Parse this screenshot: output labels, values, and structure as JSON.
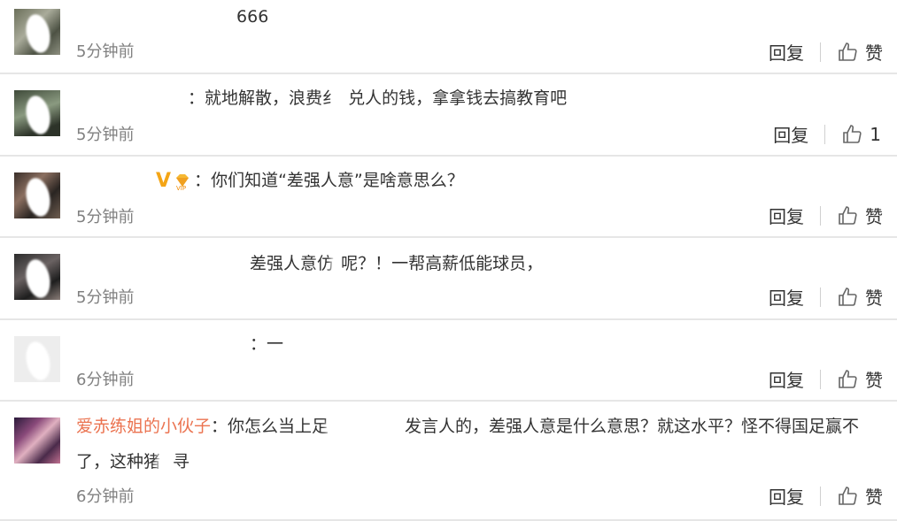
{
  "comments": [
    {
      "username": "",
      "text": "666",
      "time": "5分钟前",
      "reply_label": "回复",
      "like_label": "赞"
    },
    {
      "username": "",
      "text_a": "：就地解散，浪费纟",
      "text_b": "兑人的钱，拿拿钱去搞教育吧",
      "time": "5分钟前",
      "reply_label": "回复",
      "like_label": "1"
    },
    {
      "username": "",
      "badge_v": "V",
      "text": "：你们知道“差强人意”是啥意思么？",
      "time": "5分钟前",
      "reply_label": "回复",
      "like_label": "赞"
    },
    {
      "username": "",
      "text_a": "差强人意仿",
      "text_b": "呢？！一帮高薪低能球员，",
      "time": "5分钟前",
      "reply_label": "回复",
      "like_label": "赞"
    },
    {
      "username": "",
      "text": "：一",
      "time": "6分钟前",
      "reply_label": "回复",
      "like_label": "赞"
    },
    {
      "username": "爱赤练姐的小伙子",
      "text_a": "：你怎么当上足",
      "text_b": "发言人的，差强人意是什么意思？就这水平？怪不得国足赢不了，这种猪",
      "text_c": "寻",
      "time": "6分钟前",
      "reply_label": "回复",
      "like_label": "赞"
    }
  ],
  "colors": {
    "username": "#eb7350",
    "text": "#333333",
    "time": "#808080",
    "divider": "#e6e6e6"
  },
  "icons": {
    "like": "thumbs-up-icon",
    "vip": "vip-diamond-icon",
    "verified": "verified-v-icon"
  }
}
